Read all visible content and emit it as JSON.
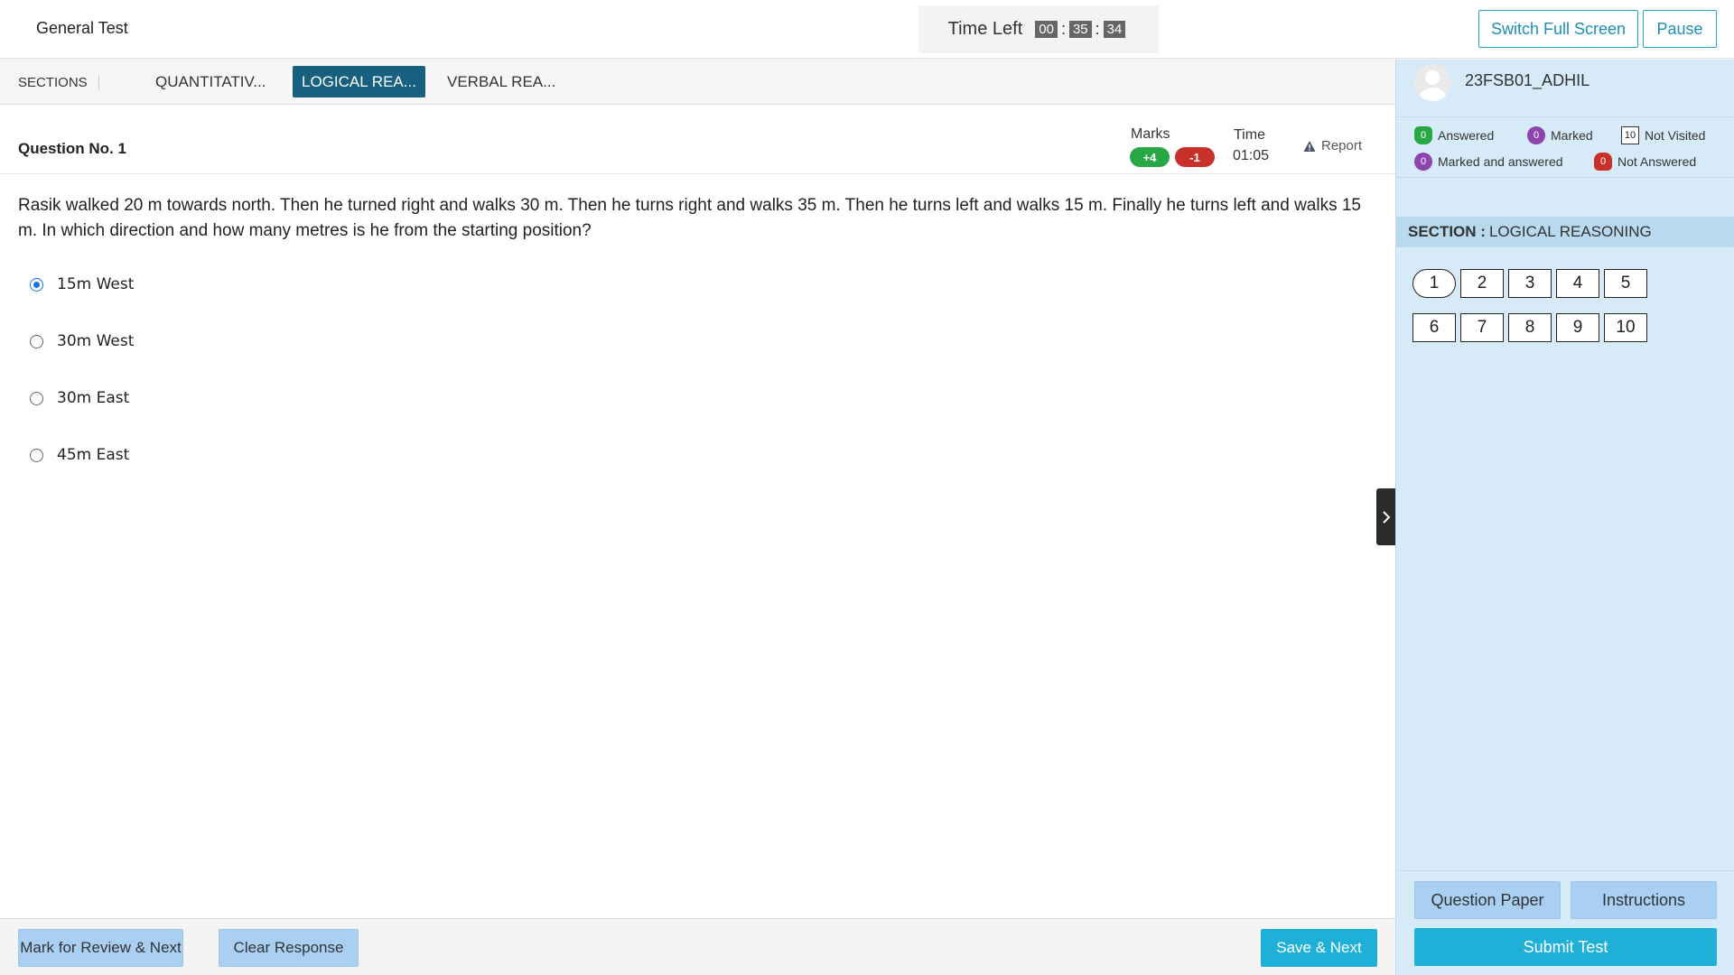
{
  "header": {
    "test_title": "General Test",
    "time_left_label": "Time Left",
    "timer": {
      "hours": "00",
      "minutes": "35",
      "seconds": "34"
    },
    "switch_fullscreen_label": "Switch Full Screen",
    "pause_label": "Pause"
  },
  "sections": {
    "label": "SECTIONS",
    "tabs": [
      {
        "label": "QUANTITATIV...",
        "active": false
      },
      {
        "label": "LOGICAL REA...",
        "active": true
      },
      {
        "label": "VERBAL REA...",
        "active": false
      }
    ]
  },
  "question": {
    "number_label": "Question No. 1",
    "marks_label": "Marks",
    "positive_marks": "+4",
    "negative_marks": "-1",
    "time_label": "Time",
    "time_value": "01:05",
    "report_label": "Report",
    "text": "Rasik walked 20 m towards north. Then he turned right and walks 30 m. Then he turns right and walks 35 m. Then he turns left and walks 15 m. Finally he turns left and walks 15 m. In which direction and how many metres is he from the starting position?",
    "options": [
      {
        "label": "15m West",
        "selected": true
      },
      {
        "label": "30m West",
        "selected": false
      },
      {
        "label": "30m East",
        "selected": false
      },
      {
        "label": "45m East",
        "selected": false
      }
    ]
  },
  "footer": {
    "mark_review_label": "Mark for Review & Next",
    "clear_response_label": "Clear Response",
    "save_next_label": "Save & Next"
  },
  "panel": {
    "user_name": "23FSB01_ADHIL",
    "legend": {
      "answered": {
        "count": "0",
        "label": "Answered"
      },
      "marked": {
        "count": "0",
        "label": "Marked"
      },
      "not_visited": {
        "count": "10",
        "label": "Not Visited"
      },
      "marked_and_answered": {
        "count": "0",
        "label": "Marked and answered"
      },
      "not_answered": {
        "count": "0",
        "label": "Not Answered"
      }
    },
    "section_prefix": "SECTION :",
    "section_name": "LOGICAL REASONING",
    "questions": [
      "1",
      "2",
      "3",
      "4",
      "5",
      "6",
      "7",
      "8",
      "9",
      "10"
    ],
    "current_question": "1",
    "question_paper_label": "Question Paper",
    "instructions_label": "Instructions",
    "submit_label": "Submit Test"
  },
  "colors": {
    "accent": "#1fb0d8",
    "active_tab": "#17607f",
    "panel_bg": "#d6ebf7",
    "answered": "#27a844",
    "marked": "#8e44ad",
    "not_answered": "#c8312a"
  }
}
